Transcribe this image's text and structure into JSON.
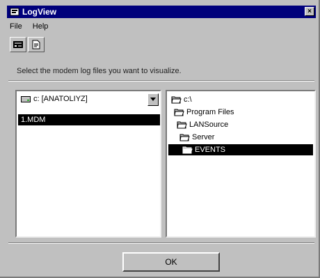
{
  "window": {
    "title": "LogView",
    "close_glyph": "×"
  },
  "menu": {
    "items": [
      {
        "label": "File"
      },
      {
        "label": "Help"
      }
    ]
  },
  "toolbar": {
    "buttons": [
      {
        "icon": "modem-log-icon"
      },
      {
        "icon": "document-icon"
      }
    ]
  },
  "instruction": "Select the modem log files you want to visualize.",
  "left_panel": {
    "drive_selected": "c: [ANATOLIYZ]",
    "files": [
      "1.MDM"
    ]
  },
  "right_panel": {
    "folders": [
      {
        "label": "c:\\",
        "depth": 0,
        "selected": false
      },
      {
        "label": "Program Files",
        "depth": 1,
        "selected": false
      },
      {
        "label": "LANSource",
        "depth": 2,
        "selected": false
      },
      {
        "label": "Server",
        "depth": 3,
        "selected": false
      },
      {
        "label": "EVENTS",
        "depth": 4,
        "selected": true
      }
    ]
  },
  "ok_button": {
    "label": "OK"
  },
  "colors": {
    "titlebar": "#00007b",
    "face": "#c0c0c0",
    "selection": "#000000"
  }
}
